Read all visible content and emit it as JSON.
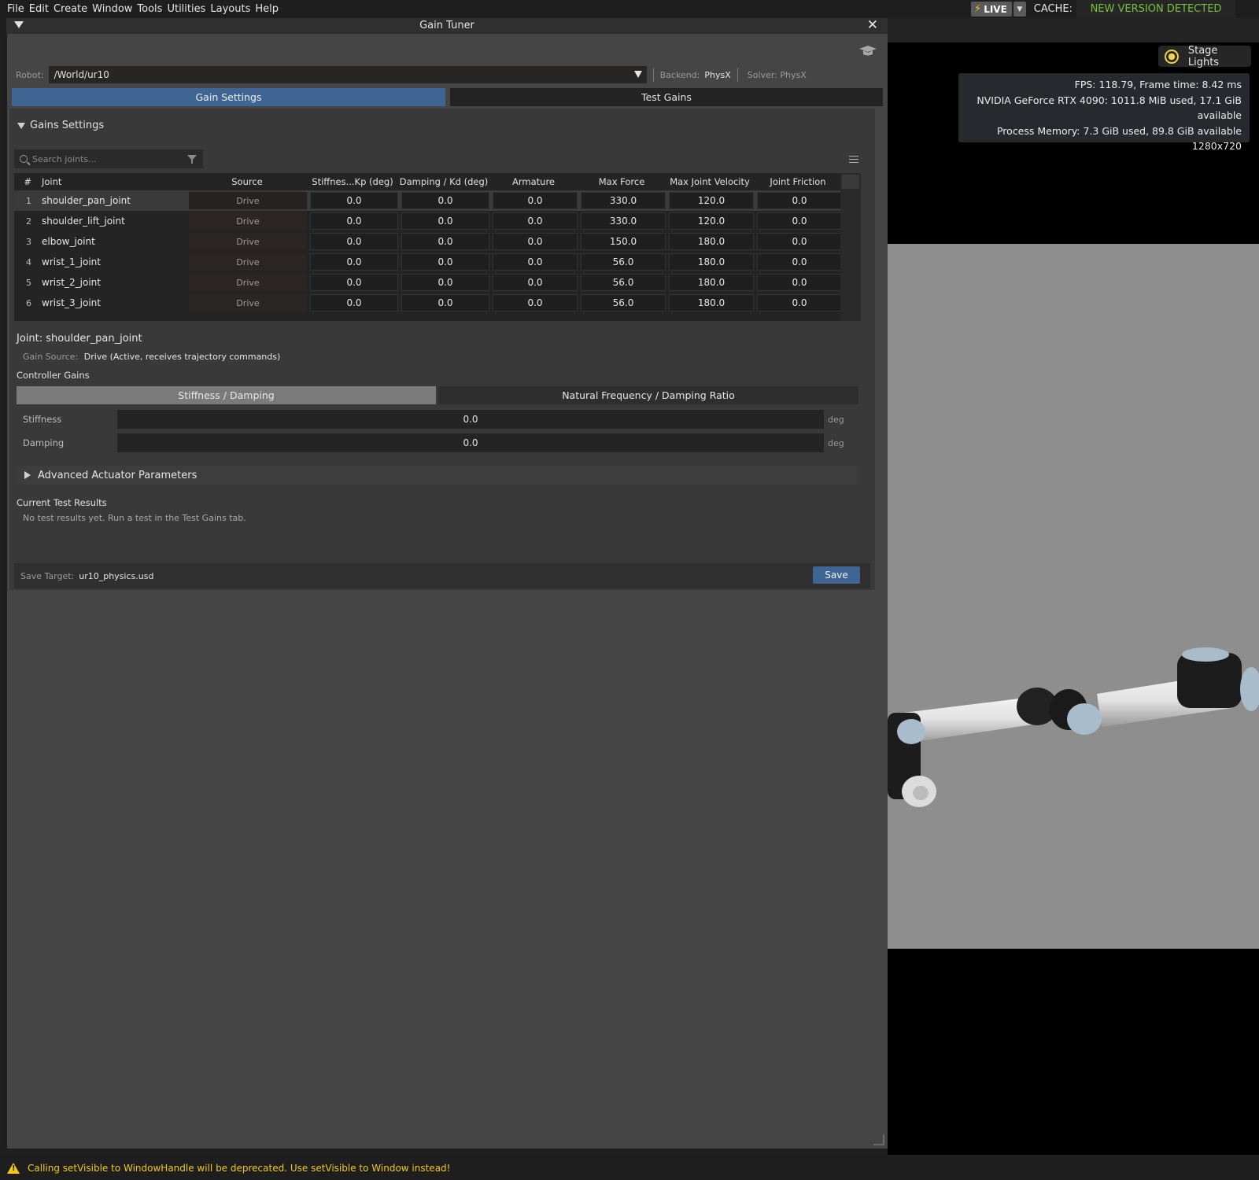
{
  "menu": [
    "File",
    "Edit",
    "Create",
    "Window",
    "Tools",
    "Utilities",
    "Layouts",
    "Help"
  ],
  "topbar": {
    "live_label": "LIVE",
    "cache_label": "CACHE:",
    "cache_status": "NEW VERSION DETECTED",
    "cache_status_color": "#76c13a"
  },
  "viewport": {
    "stage_lights": "Stage Lights",
    "stats": [
      "FPS: 118.79, Frame time: 8.42 ms",
      "NVIDIA GeForce RTX 4090: 1011.8 MiB used, 17.1 GiB available",
      "Process Memory: 7.3 GiB used, 89.8 GiB available",
      "1280x720"
    ]
  },
  "window": {
    "title": "Gain Tuner"
  },
  "robot": {
    "label": "Robot:",
    "path": "/World/ur10",
    "backend_label": "Backend:",
    "backend": "PhysX",
    "solver": "Solver: PhysX"
  },
  "tabs": {
    "gain_settings": "Gain Settings",
    "test_gains": "Test Gains"
  },
  "gains_section": {
    "title": "Gains Settings",
    "search_placeholder": "Search joints..."
  },
  "table": {
    "headers": [
      "#",
      "Joint",
      "Source",
      "Stiffnes...Kp (deg)",
      "Damping / Kd (deg)",
      "Armature",
      "Max Force",
      "Max Joint Velocity",
      "Joint Friction"
    ],
    "rows": [
      {
        "n": "1",
        "joint": "shoulder_pan_joint",
        "source": "Drive",
        "stiffness": "0.0",
        "damping": "0.0",
        "armature": "0.0",
        "max_force": "330.0",
        "max_vel": "120.0",
        "friction": "0.0"
      },
      {
        "n": "2",
        "joint": "shoulder_lift_joint",
        "source": "Drive",
        "stiffness": "0.0",
        "damping": "0.0",
        "armature": "0.0",
        "max_force": "330.0",
        "max_vel": "120.0",
        "friction": "0.0"
      },
      {
        "n": "3",
        "joint": "elbow_joint",
        "source": "Drive",
        "stiffness": "0.0",
        "damping": "0.0",
        "armature": "0.0",
        "max_force": "150.0",
        "max_vel": "180.0",
        "friction": "0.0"
      },
      {
        "n": "4",
        "joint": "wrist_1_joint",
        "source": "Drive",
        "stiffness": "0.0",
        "damping": "0.0",
        "armature": "0.0",
        "max_force": "56.0",
        "max_vel": "180.0",
        "friction": "0.0"
      },
      {
        "n": "5",
        "joint": "wrist_2_joint",
        "source": "Drive",
        "stiffness": "0.0",
        "damping": "0.0",
        "armature": "0.0",
        "max_force": "56.0",
        "max_vel": "180.0",
        "friction": "0.0"
      },
      {
        "n": "6",
        "joint": "wrist_3_joint",
        "source": "Drive",
        "stiffness": "0.0",
        "damping": "0.0",
        "armature": "0.0",
        "max_force": "56.0",
        "max_vel": "180.0",
        "friction": "0.0"
      }
    ]
  },
  "detail": {
    "joint_title": "Joint: shoulder_pan_joint",
    "gain_source_label": "Gain Source:",
    "gain_source_value": "Drive (Active, receives trajectory commands)",
    "controller_gains": "Controller Gains",
    "tab_stiffness": "Stiffness / Damping",
    "tab_natural": "Natural Frequency / Damping Ratio",
    "stiffness_label": "Stiffness",
    "stiffness_value": "0.0",
    "damping_label": "Damping",
    "damping_value": "0.0",
    "unit": "deg",
    "advanced": "Advanced Actuator Parameters",
    "results_title": "Current Test Results",
    "results_text": "No test results yet. Run a test in the Test Gains tab."
  },
  "save": {
    "label": "Save Target:",
    "target": "ur10_physics.usd",
    "button": "Save"
  },
  "status": {
    "message": "Calling setVisible to WindowHandle will be deprecated. Use setVisible to Window instead!",
    "color": "#f2c81b"
  },
  "icons": [
    "bolt-icon",
    "chevron-down-icon",
    "sun-icon",
    "close-icon",
    "graduation-cap-icon",
    "search-icon",
    "filter-icon",
    "menu-icon",
    "warning-icon"
  ]
}
